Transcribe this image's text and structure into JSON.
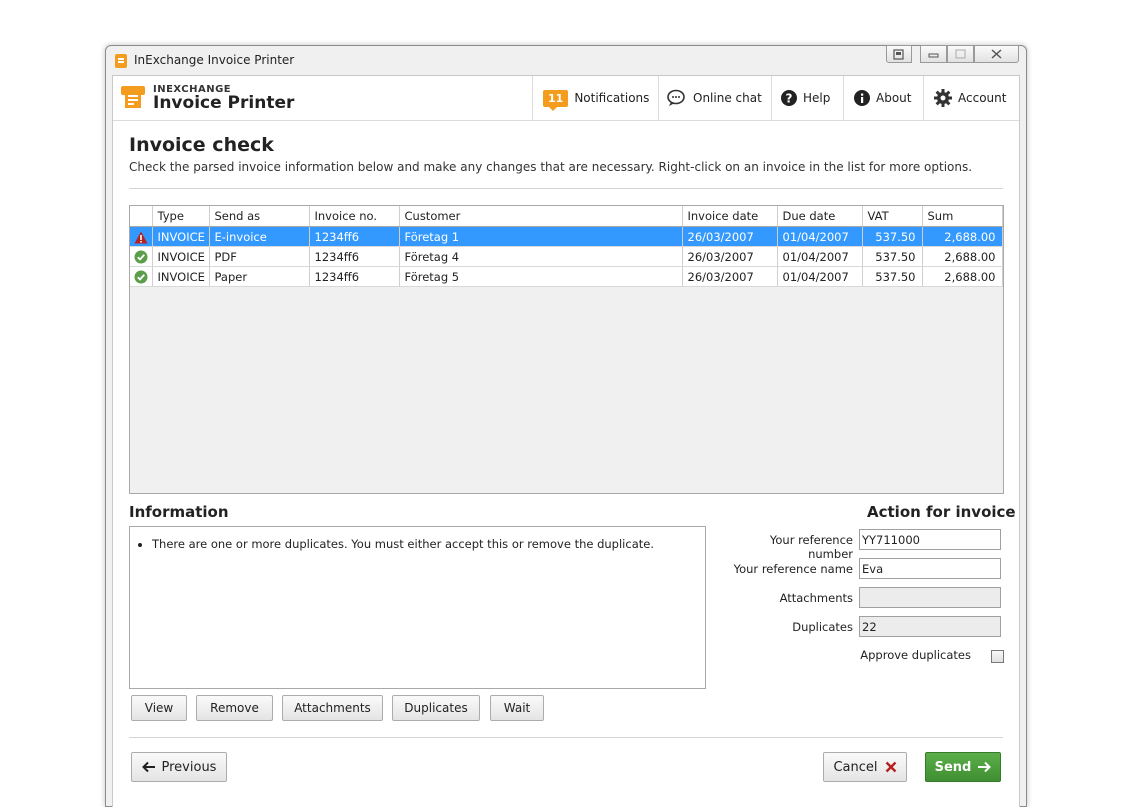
{
  "window": {
    "title": "InExchange Invoice Printer"
  },
  "brand": {
    "top": "INEXCHANGE",
    "main": "Invoice Printer"
  },
  "nav": {
    "notifications_count": "11",
    "notifications": "Notifications",
    "online_chat": "Online chat",
    "help": "Help",
    "about": "About",
    "account": "Account"
  },
  "page": {
    "title": "Invoice check",
    "description": "Check the parsed invoice information below and make any changes that are necessary. Right-click on an invoice in the list for more options."
  },
  "table": {
    "columns": [
      "Type",
      "Send as",
      "Invoice no.",
      "Customer",
      "Invoice date",
      "Due date",
      "VAT",
      "Sum"
    ],
    "rows": [
      {
        "status": "warning",
        "type": "INVOICE",
        "send_as": "E-invoice",
        "invoice_no": "1234ff6",
        "customer": "Företag 1",
        "invoice_date": "26/03/2007",
        "due_date": "01/04/2007",
        "vat": "537.50",
        "sum": "2,688.00",
        "selected": true
      },
      {
        "status": "ok",
        "type": "INVOICE",
        "send_as": "PDF",
        "invoice_no": "1234ff6",
        "customer": "Företag 4",
        "invoice_date": "26/03/2007",
        "due_date": "01/04/2007",
        "vat": "537.50",
        "sum": "2,688.00",
        "selected": false
      },
      {
        "status": "ok",
        "type": "INVOICE",
        "send_as": "Paper",
        "invoice_no": "1234ff6",
        "customer": "Företag 5",
        "invoice_date": "26/03/2007",
        "due_date": "01/04/2007",
        "vat": "537.50",
        "sum": "2,688.00",
        "selected": false
      }
    ]
  },
  "information": {
    "title": "Information",
    "messages": [
      "There are one or more duplicates. You must either accept this or remove the duplicate."
    ]
  },
  "action": {
    "title": "Action for invoice",
    "ref_number_label": "Your reference number",
    "ref_number_value": "YY711000",
    "ref_name_label": "Your reference name",
    "ref_name_value": "Eva",
    "attachments_label": "Attachments",
    "attachments_value": "",
    "duplicates_label": "Duplicates",
    "duplicates_value": "22",
    "approve_label": "Approve duplicates",
    "approve_checked": false
  },
  "buttons": {
    "view": "View",
    "remove": "Remove",
    "attachments": "Attachments",
    "duplicates": "Duplicates",
    "wait": "Wait",
    "previous": "Previous",
    "cancel": "Cancel",
    "send": "Send"
  },
  "colors": {
    "accent": "#f39c1e",
    "selection": "#3399ff",
    "send": "#4a9e3c",
    "warning": "#b52020",
    "ok": "#5a9e4a"
  }
}
